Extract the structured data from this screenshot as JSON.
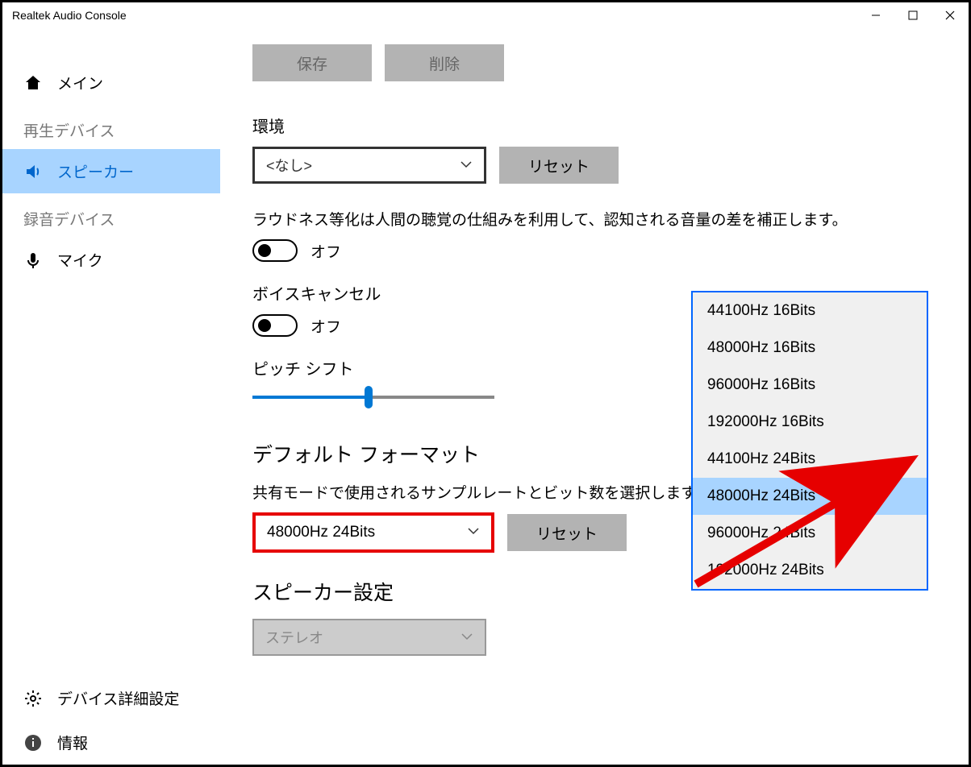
{
  "window": {
    "title": "Realtek Audio Console"
  },
  "sidebar": {
    "main": "メイン",
    "playback_header": "再生デバイス",
    "speaker": "スピーカー",
    "recording_header": "録音デバイス",
    "mic": "マイク",
    "advanced": "デバイス詳細設定",
    "info": "情報"
  },
  "buttons": {
    "save": "保存",
    "delete": "削除",
    "reset": "リセット"
  },
  "env": {
    "label": "環境",
    "selected": "<なし>"
  },
  "loudness": {
    "desc": "ラウドネス等化は人間の聴覚の仕組みを利用して、認知される音量の差を補正します。",
    "state": "オフ"
  },
  "voice_cancel": {
    "label": "ボイスキャンセル",
    "state": "オフ"
  },
  "pitch": {
    "label": "ピッチ シフト"
  },
  "default_format": {
    "title": "デフォルト フォーマット",
    "desc": "共有モードで使用されるサンプルレートとビット数を選択します。",
    "selected": "48000Hz 24Bits",
    "options": {
      "o0": "44100Hz 16Bits",
      "o1": "48000Hz 16Bits",
      "o2": "96000Hz 16Bits",
      "o3": "192000Hz 16Bits",
      "o4": "44100Hz 24Bits",
      "o5": "48000Hz 24Bits",
      "o6": "96000Hz 24Bits",
      "o7": "192000Hz 24Bits"
    }
  },
  "speaker_config": {
    "title": "スピーカー設定",
    "selected": "ステレオ"
  }
}
